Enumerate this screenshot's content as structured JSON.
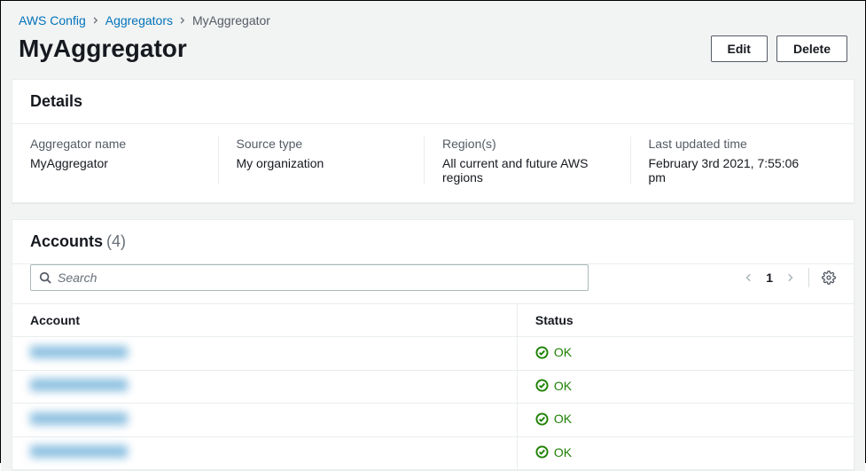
{
  "breadcrumb": {
    "root": "AWS Config",
    "mid": "Aggregators",
    "current": "MyAggregator"
  },
  "header": {
    "title": "MyAggregator",
    "edit_label": "Edit",
    "delete_label": "Delete"
  },
  "details": {
    "panel_title": "Details",
    "cols": [
      {
        "label": "Aggregator name",
        "value": "MyAggregator"
      },
      {
        "label": "Source type",
        "value": "My organization"
      },
      {
        "label": "Region(s)",
        "value": "All current and future AWS regions"
      },
      {
        "label": "Last updated time",
        "value": "February 3rd 2021, 7:55:06 pm"
      }
    ]
  },
  "accounts": {
    "panel_title": "Accounts",
    "count_display": "(4)",
    "search_placeholder": "Search",
    "page_number": "1",
    "columns": {
      "account": "Account",
      "status": "Status"
    },
    "rows": [
      {
        "status": "OK"
      },
      {
        "status": "OK"
      },
      {
        "status": "OK"
      },
      {
        "status": "OK"
      }
    ]
  },
  "colors": {
    "link": "#0073bb",
    "success": "#1d8102"
  }
}
